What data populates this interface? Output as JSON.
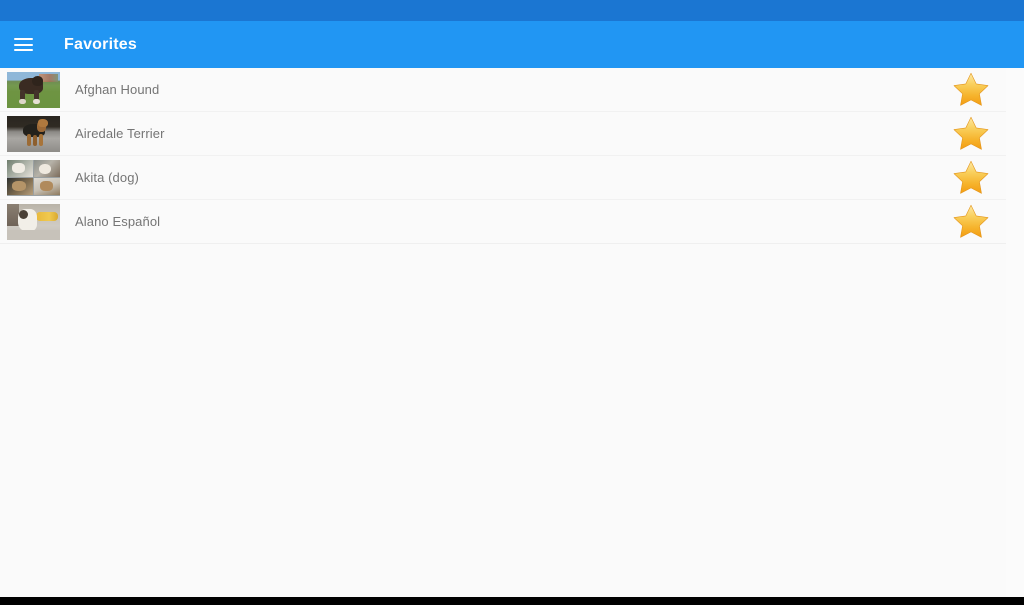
{
  "app": {
    "title": "Favorites",
    "menu_icon": "hamburger-menu-icon",
    "appbar_color": "#2196f3",
    "statusbar_color": "#1b76d2",
    "title_color": "#ffffff"
  },
  "list": {
    "background_color": "#fafafa",
    "text_color": "#757575",
    "rows": [
      {
        "title": "Afghan Hound",
        "thumbnail": "afghan-hound-thumbnail",
        "favorite_icon": "star-filled-icon",
        "favorited": true
      },
      {
        "title": "Airedale Terrier",
        "thumbnail": "airedale-terrier-thumbnail",
        "favorite_icon": "star-filled-icon",
        "favorited": true
      },
      {
        "title": "Akita (dog)",
        "thumbnail": "akita-dog-thumbnail",
        "favorite_icon": "star-filled-icon",
        "favorited": true
      },
      {
        "title": "Alano Español",
        "thumbnail": "alano-espanol-thumbnail",
        "favorite_icon": "star-filled-icon",
        "favorited": true
      }
    ]
  },
  "star": {
    "color_top": "#fbe38a",
    "color_mid": "#f6c445",
    "color_bottom": "#f5a623"
  },
  "navigation_bar": {
    "color": "#000000"
  }
}
